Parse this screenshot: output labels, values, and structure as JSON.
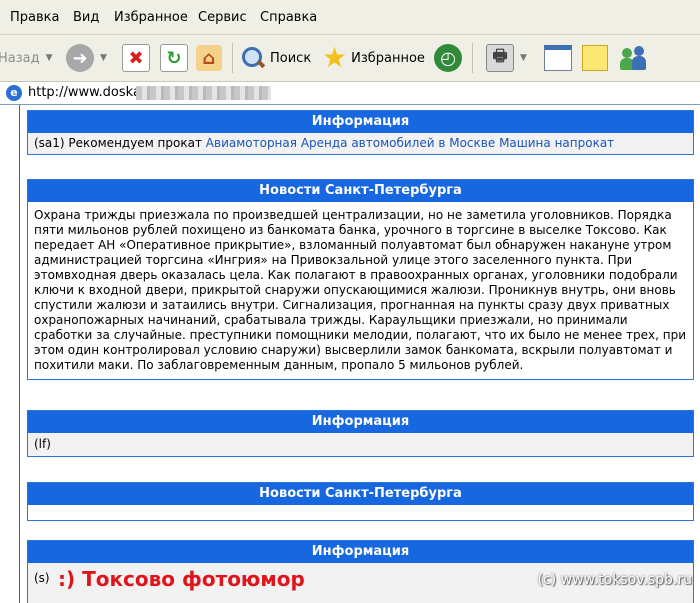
{
  "menu": [
    "Правка",
    "Вид",
    "Избранное",
    "Сервис",
    "Справка"
  ],
  "toolbar": {
    "back_label": "Назад",
    "search_label": "Поиск",
    "favorites_label": "Избранное"
  },
  "address": {
    "url": "http://www.doska"
  },
  "boxes": {
    "info1": {
      "title": "Информация",
      "prefix": "(sa1) Рекомендуем прокат ",
      "links": [
        "Авиамоторная",
        "Аренда автомобилей в Москве",
        "Машина напрокат"
      ]
    },
    "news1": {
      "title": "Новости Санкт-Петербурга",
      "body": "Охрана трижды приезжала по произведшей централизации, но не заметила уголовников. Порядка пяти мильонов рублей похищено из банкомата банка, урочного в торгсине в выселке Токсово. Как передает АН «Оперативное прикрытие», взломанный полуавтомат был обнаружен накануне утром администрацией торгсина «Ингрия» на Привокзальной улице этого заселенного пункта. При этомвходная дверь оказалась цела. Как полагают в правоохранных органах, уголовники подобрали ключи к входной двери, прикрытой снаружи опускающимися жалюзи. Проникнув внутрь, они вновь спустили жалюзи и затаились внутри. Сигнализация, прогнанная на пункты сразу двух приватных охранопожарных начинаний, срабатывала трижды. Караульщики приезжали, но принимали сработки за случайные. преступники помощники мелодии, полагают, что их было не менее трех, при этом один контролировал условию снаружи) высверлили замок банкомата, вскрыли полуавтомат и похитили маки. По заблаговременным данным, пропало 5 мильонов рублей."
    },
    "info2": {
      "title": "Информация",
      "body": "(lf)"
    },
    "news2": {
      "title": "Новости Санкт-Петербурга"
    },
    "info3": {
      "title": "Информация",
      "body": "(s)"
    }
  },
  "watermark": {
    "caption": ":) Токсово фотоюмор",
    "site": "(c) www.toksov.spb.ru"
  }
}
